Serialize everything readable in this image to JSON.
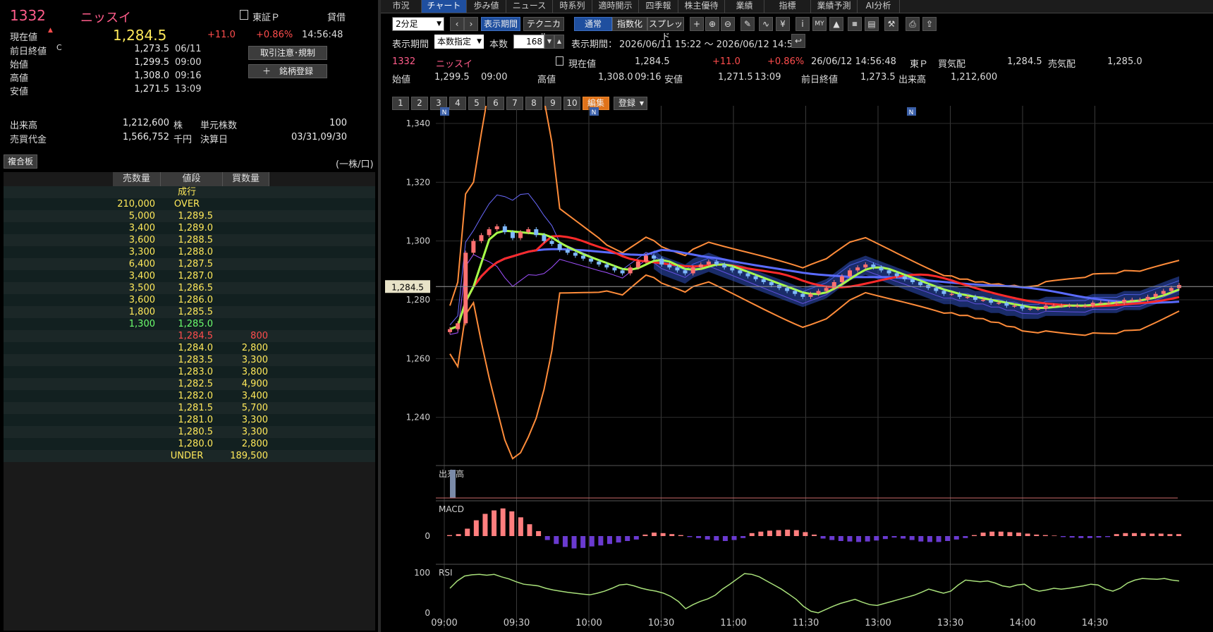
{
  "quote": {
    "code": "1332",
    "name": "ニッスイ",
    "market": "東証Ｐ",
    "margin_type": "貸借",
    "price_label": "現在値",
    "price": "1,284.5",
    "change": "+11.0",
    "change_pct": "+0.86%",
    "time": "14:56:48",
    "rows": [
      {
        "label": "前日終値",
        "mark": "C",
        "value": "1,273.5",
        "extra": "06/11"
      },
      {
        "label": "始値",
        "mark": "",
        "value": "1,299.5",
        "extra": "09:00"
      },
      {
        "label": "高値",
        "mark": "",
        "value": "1,308.0",
        "extra": "09:16"
      },
      {
        "label": "安値",
        "mark": "",
        "value": "1,271.5",
        "extra": "13:09"
      }
    ],
    "volume_label": "出来高",
    "volume": "1,212,600",
    "volume_unit": "株",
    "unit_label": "単元株数",
    "unit_value": "100",
    "turnover_label": "売買代金",
    "turnover": "1,566,752",
    "turnover_unit": "千円",
    "settle_label": "決算日",
    "settle_value": "03/31,09/30",
    "btn_rules": "取引注意･規制",
    "btn_register": "＋　銘柄登録"
  },
  "orderbook": {
    "btn": "複合板",
    "unit_note": "(一株/口)",
    "headers": [
      "売数量",
      "値段",
      "買数量"
    ],
    "rows": [
      {
        "sell": "",
        "price": "成行",
        "buy": "",
        "cls": "yellow"
      },
      {
        "sell": "210,000",
        "price": "OVER",
        "buy": "",
        "cls": "yellow"
      },
      {
        "sell": "5,000",
        "price": "1,289.5",
        "buy": "",
        "cls": "yellow"
      },
      {
        "sell": "3,400",
        "price": "1,289.0",
        "buy": "",
        "cls": "yellow"
      },
      {
        "sell": "3,600",
        "price": "1,288.5",
        "buy": "",
        "cls": "yellow"
      },
      {
        "sell": "3,300",
        "price": "1,288.0",
        "buy": "",
        "cls": "yellow"
      },
      {
        "sell": "6,400",
        "price": "1,287.5",
        "buy": "",
        "cls": "yellow"
      },
      {
        "sell": "3,400",
        "price": "1,287.0",
        "buy": "",
        "cls": "yellow"
      },
      {
        "sell": "3,500",
        "price": "1,286.5",
        "buy": "",
        "cls": "yellow"
      },
      {
        "sell": "3,600",
        "price": "1,286.0",
        "buy": "",
        "cls": "yellow"
      },
      {
        "sell": "1,800",
        "price": "1,285.5",
        "buy": "",
        "cls": "yellow"
      },
      {
        "sell": "1,300",
        "price": "1,285.0",
        "buy": "",
        "cls": "green"
      },
      {
        "sell": "",
        "price": "1,284.5",
        "buy": "800",
        "cls": "red"
      },
      {
        "sell": "",
        "price": "1,284.0",
        "buy": "2,800",
        "cls": "yellow"
      },
      {
        "sell": "",
        "price": "1,283.5",
        "buy": "3,300",
        "cls": "yellow"
      },
      {
        "sell": "",
        "price": "1,283.0",
        "buy": "3,800",
        "cls": "yellow"
      },
      {
        "sell": "",
        "price": "1,282.5",
        "buy": "4,900",
        "cls": "yellow"
      },
      {
        "sell": "",
        "price": "1,282.0",
        "buy": "3,400",
        "cls": "yellow"
      },
      {
        "sell": "",
        "price": "1,281.5",
        "buy": "5,700",
        "cls": "yellow"
      },
      {
        "sell": "",
        "price": "1,281.0",
        "buy": "3,300",
        "cls": "yellow"
      },
      {
        "sell": "",
        "price": "1,280.5",
        "buy": "3,300",
        "cls": "yellow"
      },
      {
        "sell": "",
        "price": "1,280.0",
        "buy": "2,800",
        "cls": "yellow"
      },
      {
        "sell": "",
        "price": "UNDER",
        "buy": "189,500",
        "cls": "yellow"
      }
    ]
  },
  "tabs": [
    "市況",
    "チャート",
    "歩み値",
    "ニュース",
    "時系列",
    "適時開示",
    "四季報",
    "株主優待",
    "業績",
    "指標",
    "業績予測",
    "AI分析"
  ],
  "active_tab": "チャート",
  "toolbar": {
    "interval": "2分足",
    "period_btn": "表示期間",
    "technical_btn": "テクニカル",
    "normal_btn": "通常",
    "index_btn": "指数化",
    "spread_btn": "スプレッド"
  },
  "period": {
    "label": "表示期間",
    "mode": "本数指定",
    "count_label": "本数",
    "count": "168",
    "range_label": "表示期間：",
    "range": "2026/06/11 15:22 ～ 2026/06/12 14:56"
  },
  "chart_info": {
    "code": "1332",
    "name": "ニッスイ",
    "price_label": "現在値",
    "price": "1,284.5",
    "change": "+11.0",
    "change_pct": "+0.86%",
    "datetime": "26/06/12  14:56:48",
    "market": "東Ｐ",
    "bid_label": "買気配",
    "bid": "1,284.5",
    "ask_label": "売気配",
    "ask": "1,285.0",
    "open_label": "始値",
    "open": "1,299.5",
    "open_time": "09:00",
    "high_label": "高値",
    "high": "1,308.0",
    "high_time": "09:16",
    "low_label": "安値",
    "low": "1,271.5",
    "low_time": "13:09",
    "prev_label": "前日終値",
    "prev": "1,273.5",
    "vol_label": "出来高",
    "vol": "1,212,600"
  },
  "number_tabs": [
    "1",
    "2",
    "3",
    "4",
    "5",
    "6",
    "7",
    "8",
    "9",
    "10"
  ],
  "edit_btn": "編集",
  "register_btn": "登録",
  "news_marker": "N",
  "colors": {
    "accent": "#1f4f9f",
    "up": "#ff4d4d",
    "down": "#6dff6d",
    "name": "#ff5c8a"
  },
  "chart_data": {
    "type": "candlestick",
    "xlabels": [
      "09:00",
      "09:30",
      "10:00",
      "10:30",
      "11:00",
      "11:30",
      "13:00",
      "13:30",
      "14:00",
      "14:30"
    ],
    "ylabels": [
      "1,340",
      "1,320",
      "1,300",
      "1,280",
      "1,260",
      "1,240"
    ],
    "yticks": [
      1340,
      1320,
      1300,
      1280,
      1260,
      1240
    ],
    "ylim": [
      1226,
      1346
    ],
    "current_price_label": "1,284.5",
    "current_price": 1284.5,
    "close": [
      1270,
      1272,
      1296,
      1300,
      1302,
      1304,
      1305,
      1303,
      1301,
      1303,
      1304,
      1302,
      1300,
      1299,
      1297,
      1296,
      1295,
      1294,
      1293,
      1292,
      1291,
      1290,
      1289,
      1291,
      1293,
      1295,
      1294,
      1292,
      1291,
      1290,
      1289,
      1291,
      1292,
      1293,
      1292,
      1291,
      1290,
      1289,
      1288,
      1287,
      1286,
      1285,
      1284,
      1283,
      1282,
      1281,
      1282,
      1283,
      1284,
      1286,
      1288,
      1290,
      1291,
      1292,
      1291,
      1290,
      1289,
      1288,
      1287,
      1286,
      1285,
      1284,
      1283,
      1282,
      1282,
      1281,
      1281,
      1280,
      1280,
      1279,
      1279,
      1278,
      1278,
      1277,
      1277,
      1277,
      1278,
      1278,
      1278,
      1278,
      1278,
      1278,
      1279,
      1279,
      1279,
      1279,
      1280,
      1280,
      1280,
      1281,
      1282,
      1283,
      1284,
      1285
    ],
    "volume_label": "出来高",
    "macd_label": "MACD",
    "macd_zero": "0",
    "macd": [
      0.2,
      0.4,
      1.5,
      3.2,
      4.5,
      5.2,
      5.6,
      5.0,
      3.8,
      2.4,
      1.0,
      -0.8,
      -1.6,
      -2.2,
      -2.5,
      -2.4,
      -2.1,
      -1.9,
      -1.6,
      -1.3,
      -1.0,
      -0.7,
      0.3,
      0.7,
      0.6,
      0.4,
      0.2,
      -0.2,
      -0.4,
      -0.7,
      -0.9,
      -1.0,
      -0.8,
      -0.4,
      0.6,
      0.9,
      1.1,
      1.2,
      1.3,
      1.2,
      0.8,
      0.3,
      -0.5,
      -0.8,
      -1.0,
      -1.1,
      -1.2,
      -1.1,
      -0.9,
      -0.6,
      -0.3,
      -0.5,
      -0.8,
      -1.1,
      -1.2,
      -1.2,
      -1.0,
      -0.7,
      -0.4,
      0.2,
      0.7,
      0.9,
      0.9,
      0.8,
      0.7,
      0.5,
      0.3,
      0.2,
      0.1,
      -0.2,
      -0.3,
      -0.4,
      -0.4,
      -0.3,
      -0.2,
      0.4,
      0.6,
      0.6,
      0.6,
      0.5,
      0.5,
      0.4,
      0.4
    ],
    "rsi_label": "RSI",
    "rsi_100": "100",
    "rsi_0": "0",
    "rsi": [
      62,
      80,
      92,
      95,
      96,
      94,
      96,
      90,
      85,
      78,
      72,
      70,
      68,
      62,
      58,
      55,
      52,
      50,
      48,
      46,
      50,
      55,
      62,
      70,
      72,
      68,
      62,
      58,
      55,
      50,
      42,
      30,
      12,
      22,
      30,
      36,
      45,
      60,
      72,
      85,
      98,
      96,
      90,
      80,
      70,
      60,
      48,
      35,
      18,
      6,
      2,
      10,
      18,
      25,
      30,
      35,
      28,
      22,
      20,
      25,
      30,
      35,
      40,
      45,
      52,
      60,
      55,
      50,
      55,
      70,
      82,
      80,
      78,
      80,
      75,
      68,
      65,
      70,
      72,
      60,
      55,
      58,
      62,
      60,
      62,
      65,
      68,
      72,
      70,
      60,
      55,
      62,
      75,
      82,
      86,
      85,
      84,
      86,
      82,
      80
    ]
  }
}
